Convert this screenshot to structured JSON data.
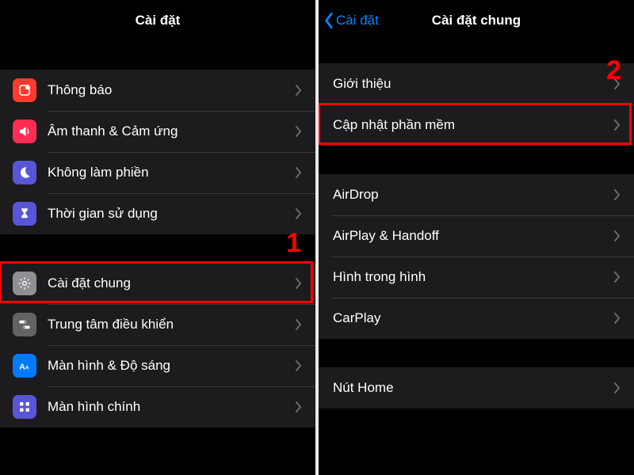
{
  "annotation": {
    "step1": "1",
    "step2": "2"
  },
  "left": {
    "title": "Cài đặt",
    "groups": [
      {
        "rows": [
          {
            "id": "notifications",
            "label": "Thông báo",
            "icon": "notifications-icon",
            "bg": "bg-red"
          },
          {
            "id": "sounds",
            "label": "Âm thanh & Cảm ứng",
            "icon": "sounds-icon",
            "bg": "bg-pink"
          },
          {
            "id": "do-not-disturb",
            "label": "Không làm phiền",
            "icon": "moon-icon",
            "bg": "bg-indigo"
          },
          {
            "id": "screen-time",
            "label": "Thời gian sử dụng",
            "icon": "hourglass-icon",
            "bg": "bg-indigo"
          }
        ]
      },
      {
        "rows": [
          {
            "id": "general",
            "label": "Cài đặt chung",
            "icon": "gear-icon",
            "bg": "bg-gray",
            "highlight": true
          },
          {
            "id": "control-center",
            "label": "Trung tâm điều khiển",
            "icon": "toggles-icon",
            "bg": "bg-graydk"
          },
          {
            "id": "display",
            "label": "Màn hình & Độ sáng",
            "icon": "text-size-icon",
            "bg": "bg-blue"
          },
          {
            "id": "home-screen",
            "label": "Màn hình chính",
            "icon": "apps-grid-icon",
            "bg": "bg-indigo"
          }
        ]
      }
    ]
  },
  "right": {
    "title": "Cài đặt chung",
    "back": "Cài đặt",
    "groups": [
      {
        "rows": [
          {
            "id": "about",
            "label": "Giới thiệu"
          },
          {
            "id": "software-update",
            "label": "Cập nhật phần mềm",
            "highlight": true
          }
        ]
      },
      {
        "rows": [
          {
            "id": "airdrop",
            "label": "AirDrop"
          },
          {
            "id": "airplay",
            "label": "AirPlay & Handoff"
          },
          {
            "id": "pip",
            "label": "Hình trong hình"
          },
          {
            "id": "carplay",
            "label": "CarPlay"
          }
        ]
      },
      {
        "rows": [
          {
            "id": "home-button",
            "label": "Nút Home"
          }
        ]
      }
    ]
  }
}
